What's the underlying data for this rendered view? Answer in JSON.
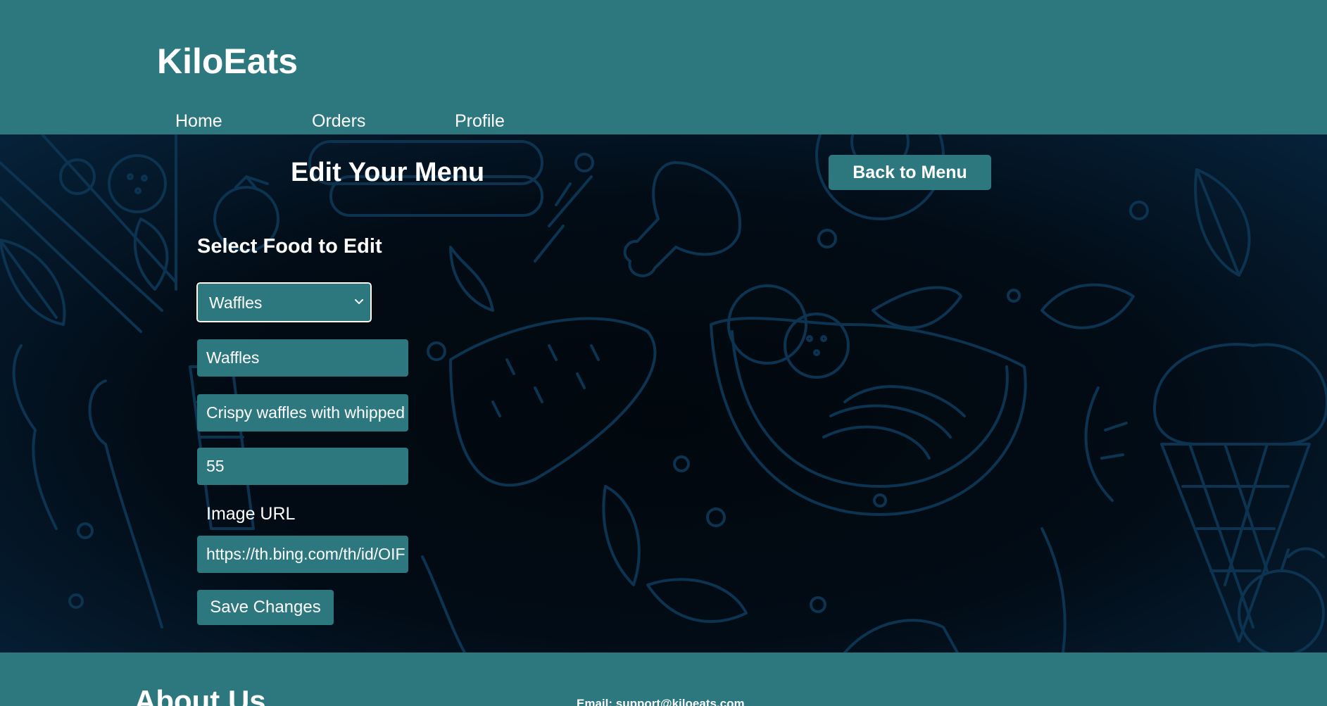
{
  "header": {
    "brand": "KiloEats",
    "nav": [
      {
        "label": "Home"
      },
      {
        "label": "Orders"
      },
      {
        "label": "Profile"
      }
    ]
  },
  "main": {
    "title": "Edit Your Menu",
    "back_button": "Back to Menu",
    "section_title": "Select Food to Edit",
    "food_select": {
      "selected": "Waffles",
      "icon": "chevron-down-icon"
    },
    "fields": {
      "name": "Waffles",
      "description": "Crispy waffles with whipped",
      "price": "55",
      "image_url_label": "Image URL",
      "image_url": "https://th.bing.com/th/id/OIF"
    },
    "save_button": "Save Changes"
  },
  "footer": {
    "about_title": "About Us",
    "email": "Email: support@kiloeats.com"
  },
  "colors": {
    "teal": "#2d777f",
    "background_dark": "#020c16",
    "doodle_stroke": "#0c3350",
    "text": "#ffffff"
  }
}
